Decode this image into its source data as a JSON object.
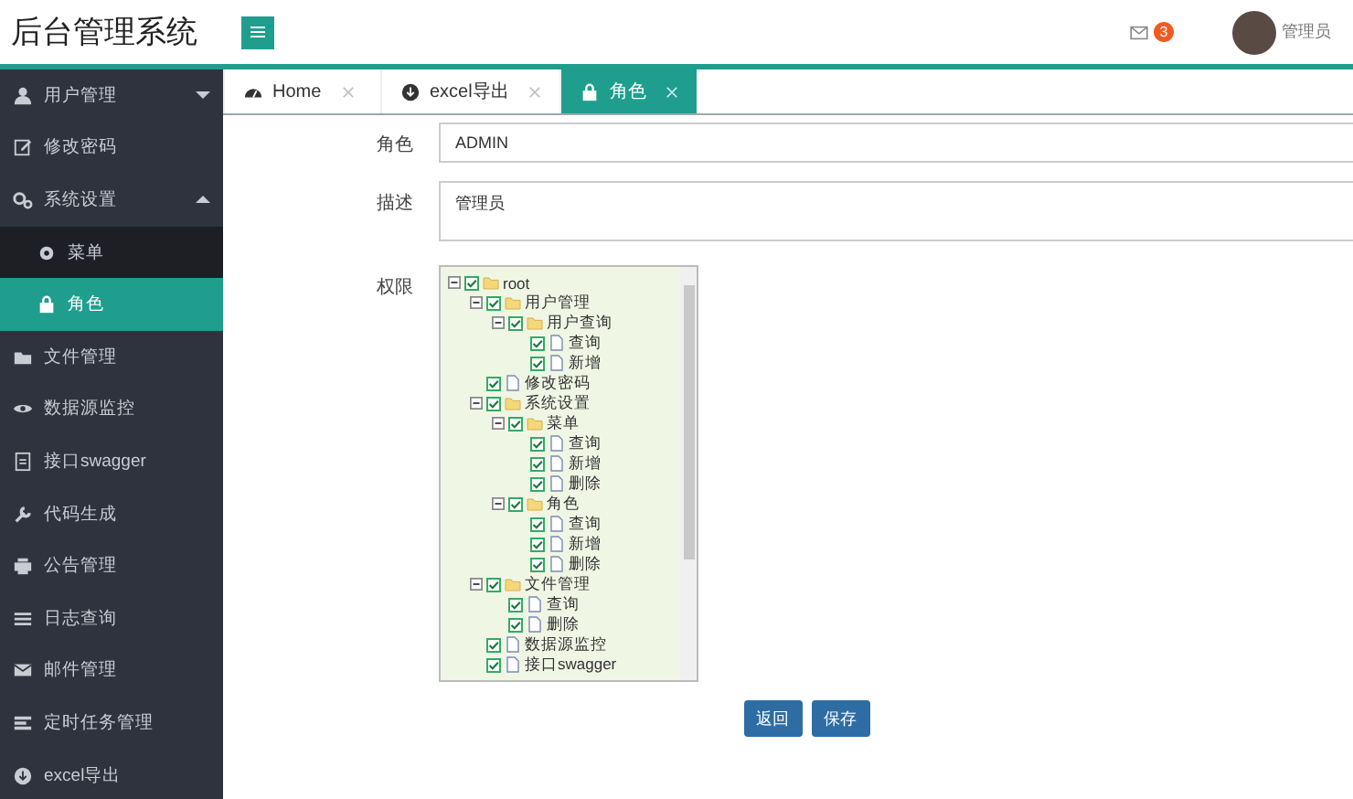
{
  "header": {
    "title": "后台管理系统",
    "message_count": "3",
    "user_name": "管理员"
  },
  "sidebar": {
    "items": [
      {
        "label": "用户管理",
        "selected": false,
        "expanded": false
      },
      {
        "label": "修改密码",
        "selected": false
      },
      {
        "label": "系统设置",
        "selected": false,
        "expanded": true,
        "children": [
          {
            "label": "菜单",
            "selected": false
          },
          {
            "label": "角色",
            "selected": true
          }
        ]
      },
      {
        "label": "文件管理",
        "selected": false
      },
      {
        "label": "数据源监控",
        "selected": false
      },
      {
        "label": "接口swagger",
        "selected": false
      },
      {
        "label": "代码生成",
        "selected": false
      },
      {
        "label": "公告管理",
        "selected": false
      },
      {
        "label": "日志查询",
        "selected": false
      },
      {
        "label": "邮件管理",
        "selected": false
      },
      {
        "label": "定时任务管理",
        "selected": false
      },
      {
        "label": "excel导出",
        "selected": false
      }
    ]
  },
  "tabs": [
    {
      "label": "Home",
      "selected": false
    },
    {
      "label": "excel导出",
      "selected": false
    },
    {
      "label": "角色",
      "selected": true
    }
  ],
  "form": {
    "role_label": "角色",
    "role_value": "ADMIN",
    "description_label": "描述",
    "description_value": "管理员",
    "permissions_label": "权限",
    "tree": [
      {
        "label": "root",
        "checked": true,
        "expanded": true,
        "children": [
          {
            "label": "用户管理",
            "checked": true,
            "expanded": true,
            "children": [
              {
                "label": "用户查询",
                "checked": true,
                "expanded": true,
                "children": [
                  {
                    "label": "查询",
                    "checked": true
                  },
                  {
                    "label": "新增",
                    "checked": true
                  }
                ]
              }
            ]
          },
          {
            "label": "修改密码",
            "checked": true
          },
          {
            "label": "系统设置",
            "checked": true,
            "expanded": true,
            "children": [
              {
                "label": "菜单",
                "checked": true,
                "expanded": true,
                "children": [
                  {
                    "label": "查询",
                    "checked": true
                  },
                  {
                    "label": "新增",
                    "checked": true
                  },
                  {
                    "label": "删除",
                    "checked": true
                  }
                ]
              },
              {
                "label": "角色",
                "checked": true,
                "expanded": true,
                "children": [
                  {
                    "label": "查询",
                    "checked": true
                  },
                  {
                    "label": "新增",
                    "checked": true
                  },
                  {
                    "label": "删除",
                    "checked": true
                  }
                ]
              }
            ]
          },
          {
            "label": "文件管理",
            "checked": true,
            "expanded": true,
            "children": [
              {
                "label": "查询",
                "checked": true
              },
              {
                "label": "删除",
                "checked": true
              }
            ]
          },
          {
            "label": "数据源监控",
            "checked": true
          },
          {
            "label": "接口swagger",
            "checked": true
          }
        ]
      }
    ]
  },
  "buttons": [
    "返回",
    "保存"
  ]
}
